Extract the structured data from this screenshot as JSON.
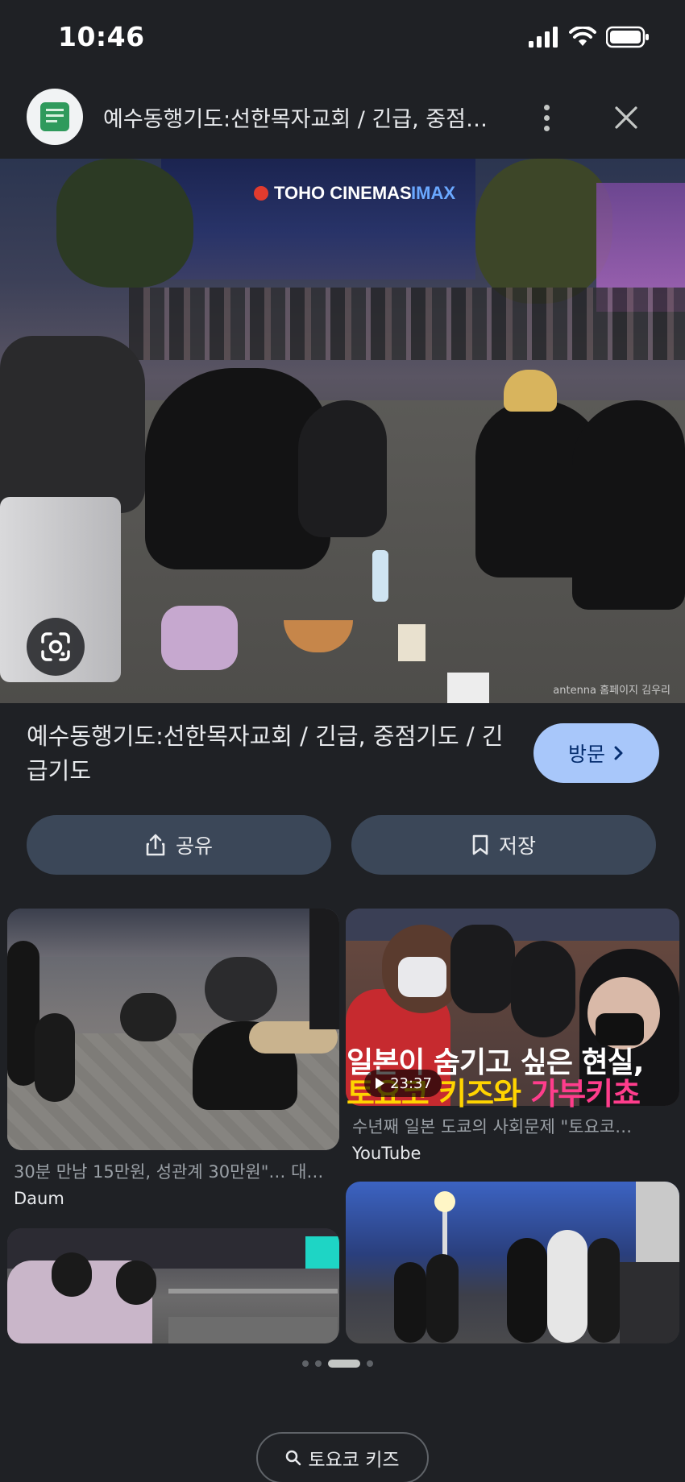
{
  "status": {
    "time": "10:46"
  },
  "header": {
    "title": "예수동행기도:선한목자교회 / 긴급, 중점…"
  },
  "main_image": {
    "sign": "TOHO CINEMAS",
    "sign2": "IMAX",
    "watermark": "antenna 홈페이지 김우리"
  },
  "page": {
    "title": "예수동행기도:선한목자교회 / 긴급, 중점기도 / 긴급기도",
    "visit_label": "방문",
    "share_label": "공유",
    "save_label": "저장"
  },
  "related": [
    {
      "caption": "30분 만남 15만원, 성관계 30만원\"… 대…",
      "source": "Daum"
    },
    {
      "caption": "수년째 일본 도쿄의 사회문제 \"토요코…",
      "source": "YouTube",
      "duration": "23:37",
      "overlay_line1": "일본이 숨기고 싶은 현실,",
      "overlay_line2a": "토요코 키즈와 ",
      "overlay_line2b": "가부키쵸"
    }
  ],
  "search_chip": {
    "label": "토요코 키즈"
  },
  "colors": {
    "background": "#1f2125",
    "visit_button": "#a8c7fa",
    "action_button": "#3b4758"
  }
}
